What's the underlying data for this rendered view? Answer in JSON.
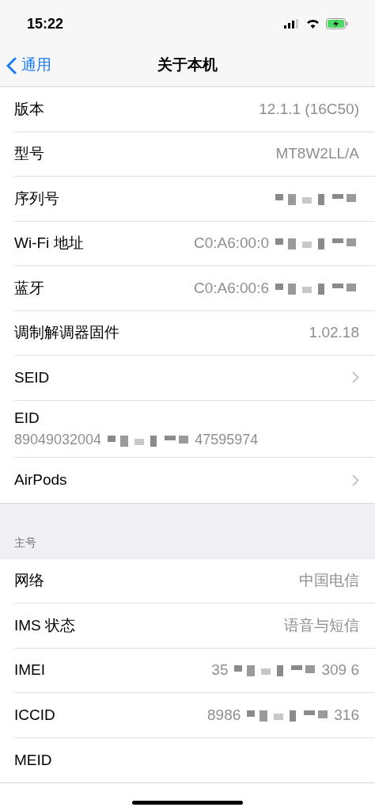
{
  "status_bar": {
    "time": "15:22"
  },
  "nav": {
    "back": "通用",
    "title": "关于本机"
  },
  "sections": [
    {
      "rows": [
        {
          "kind": "value",
          "label": "版本",
          "value_before": "12.1.1 (16C50)"
        },
        {
          "kind": "value",
          "label": "型号",
          "value_before": "MT8W2LL/A"
        },
        {
          "kind": "value",
          "label": "序列号",
          "redacted": true
        },
        {
          "kind": "value",
          "label": "Wi-Fi 地址",
          "value_before": "C0:A6:00:0",
          "redacted": true
        },
        {
          "kind": "value",
          "label": "蓝牙",
          "value_before": "C0:A6:00:6",
          "redacted": true
        },
        {
          "kind": "value",
          "label": "调制解调器固件",
          "value_before": "1.02.18"
        },
        {
          "kind": "chevron",
          "label": "SEID"
        },
        {
          "kind": "stacked",
          "label": "EID",
          "value_before": "89049032004",
          "value_after": "47595974",
          "redacted": true
        },
        {
          "kind": "chevron",
          "label": "AirPods"
        }
      ]
    },
    {
      "header": "主号",
      "rows": [
        {
          "kind": "value",
          "label": "网络",
          "value_before": "中国电信"
        },
        {
          "kind": "value",
          "label": "IMS 状态",
          "value_before": "语音与短信"
        },
        {
          "kind": "value",
          "label": "IMEI",
          "value_before": "35",
          "value_after": "309 6",
          "redacted": true
        },
        {
          "kind": "value",
          "label": "ICCID",
          "value_before": "8986",
          "value_after": "316",
          "redacted": true
        },
        {
          "kind": "value",
          "label": "MEID"
        }
      ]
    }
  ]
}
